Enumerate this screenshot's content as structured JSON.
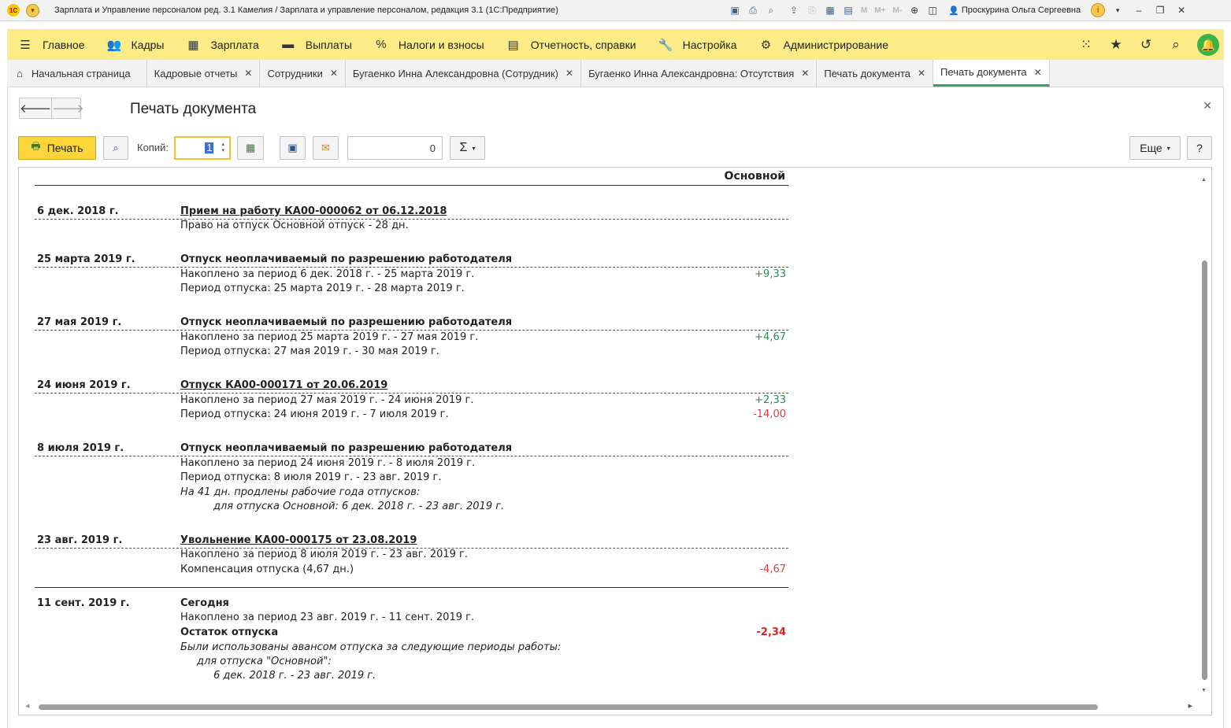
{
  "window": {
    "title": "Зарплата и Управление персоналом ред. 3.1 Камелия / Зарплата и управление персоналом, редакция 3.1  (1С:Предприятие)",
    "logo_text": "1С",
    "memory_buttons": [
      "M",
      "M+",
      "M-"
    ],
    "user": "Проскурина Ольга Сергеевна"
  },
  "sections": [
    {
      "label": "Главное",
      "icon": "menu-icon"
    },
    {
      "label": "Кадры",
      "icon": "people-icon"
    },
    {
      "label": "Зарплата",
      "icon": "calculator-icon"
    },
    {
      "label": "Выплаты",
      "icon": "wallet-icon"
    },
    {
      "label": "Налоги и взносы",
      "icon": "percent-icon"
    },
    {
      "label": "Отчетность, справки",
      "icon": "report-icon"
    },
    {
      "label": "Настройка",
      "icon": "wrench-icon"
    },
    {
      "label": "Администрирование",
      "icon": "gear-icon"
    }
  ],
  "tabs": [
    {
      "label": "Начальная страница"
    },
    {
      "label": "Кадровые отчеты"
    },
    {
      "label": "Сотрудники"
    },
    {
      "label": "Бугаенко Инна Александровна (Сотрудник)"
    },
    {
      "label": "Бугаенко Инна Александровна: Отсутствия"
    },
    {
      "label": "Печать документа"
    },
    {
      "label": "Печать документа"
    }
  ],
  "form": {
    "title": "Печать документа",
    "print_label": "Печать",
    "copies_label": "Копий:",
    "copies_value": "1",
    "sum_value": "0",
    "sum_symbol": "Σ",
    "more_label": "Еще",
    "help_label": "?"
  },
  "report": {
    "header": "Основной",
    "entries": [
      {
        "date": "6 дек. 2018 г.",
        "title": "Прием на работу КА00-000062 от 06.12.2018",
        "line1": "Право на отпуск Основной отпуск - 28 дн."
      },
      {
        "date": "25 марта 2019 г.",
        "title": "Отпуск неоплачиваемый по разрешению работодателя",
        "line1": "Накоплено за период 6 дек. 2018 г. - 25 марта 2019 г.",
        "amount1": "+9,33",
        "line2": "Период отпуска: 25 марта 2019 г. - 28 марта 2019 г."
      },
      {
        "date": "27 мая 2019 г.",
        "title": "Отпуск неоплачиваемый по разрешению работодателя",
        "line1": "Накоплено за период 25 марта 2019 г. - 27 мая 2019 г.",
        "amount1": "+4,67",
        "line2": "Период отпуска: 27 мая 2019 г. - 30 мая 2019 г."
      },
      {
        "date": "24 июня 2019 г.",
        "title": "Отпуск КА00-000171 от 20.06.2019",
        "line1": "Накоплено за период 27 мая 2019 г. - 24 июня 2019 г.",
        "amount1": "+2,33",
        "line2": "Период отпуска: 24 июня 2019 г. - 7 июля 2019 г.",
        "amount2": "-14,00"
      },
      {
        "date": "8 июля 2019 г.",
        "title": "Отпуск неоплачиваемый по разрешению работодателя",
        "line1": "Накоплено за период 24 июня 2019 г. - 8 июля 2019 г.",
        "line2": "Период отпуска: 8 июля 2019 г. - 23 авг. 2019 г.",
        "line3": "На 41 дн. продлены рабочие года отпусков:",
        "line4": "для отпуска Основной: 6 дек. 2018 г. - 23 авг. 2019 г."
      },
      {
        "date": "23 авг. 2019 г.",
        "title": "Увольнение КА00-000175 от 23.08.2019",
        "line1": "Накоплено за период 8 июля 2019 г. - 23 авг. 2019 г.",
        "line2": "Компенсация отпуска (4,67 дн.)",
        "amount2": "-4,67"
      },
      {
        "date": "11 сент. 2019 г.",
        "title": "Сегодня",
        "line1": "Накоплено за период 23 авг. 2019 г. - 11 сент. 2019 г.",
        "line2": "Остаток отпуска",
        "amount2": "-2,34",
        "line3": "Были использованы авансом отпуска за следующие периоды работы:",
        "line4": "для отпуска \"Основной\":",
        "line5": "6 дек. 2018 г. - 23 авг. 2019 г."
      }
    ]
  }
}
